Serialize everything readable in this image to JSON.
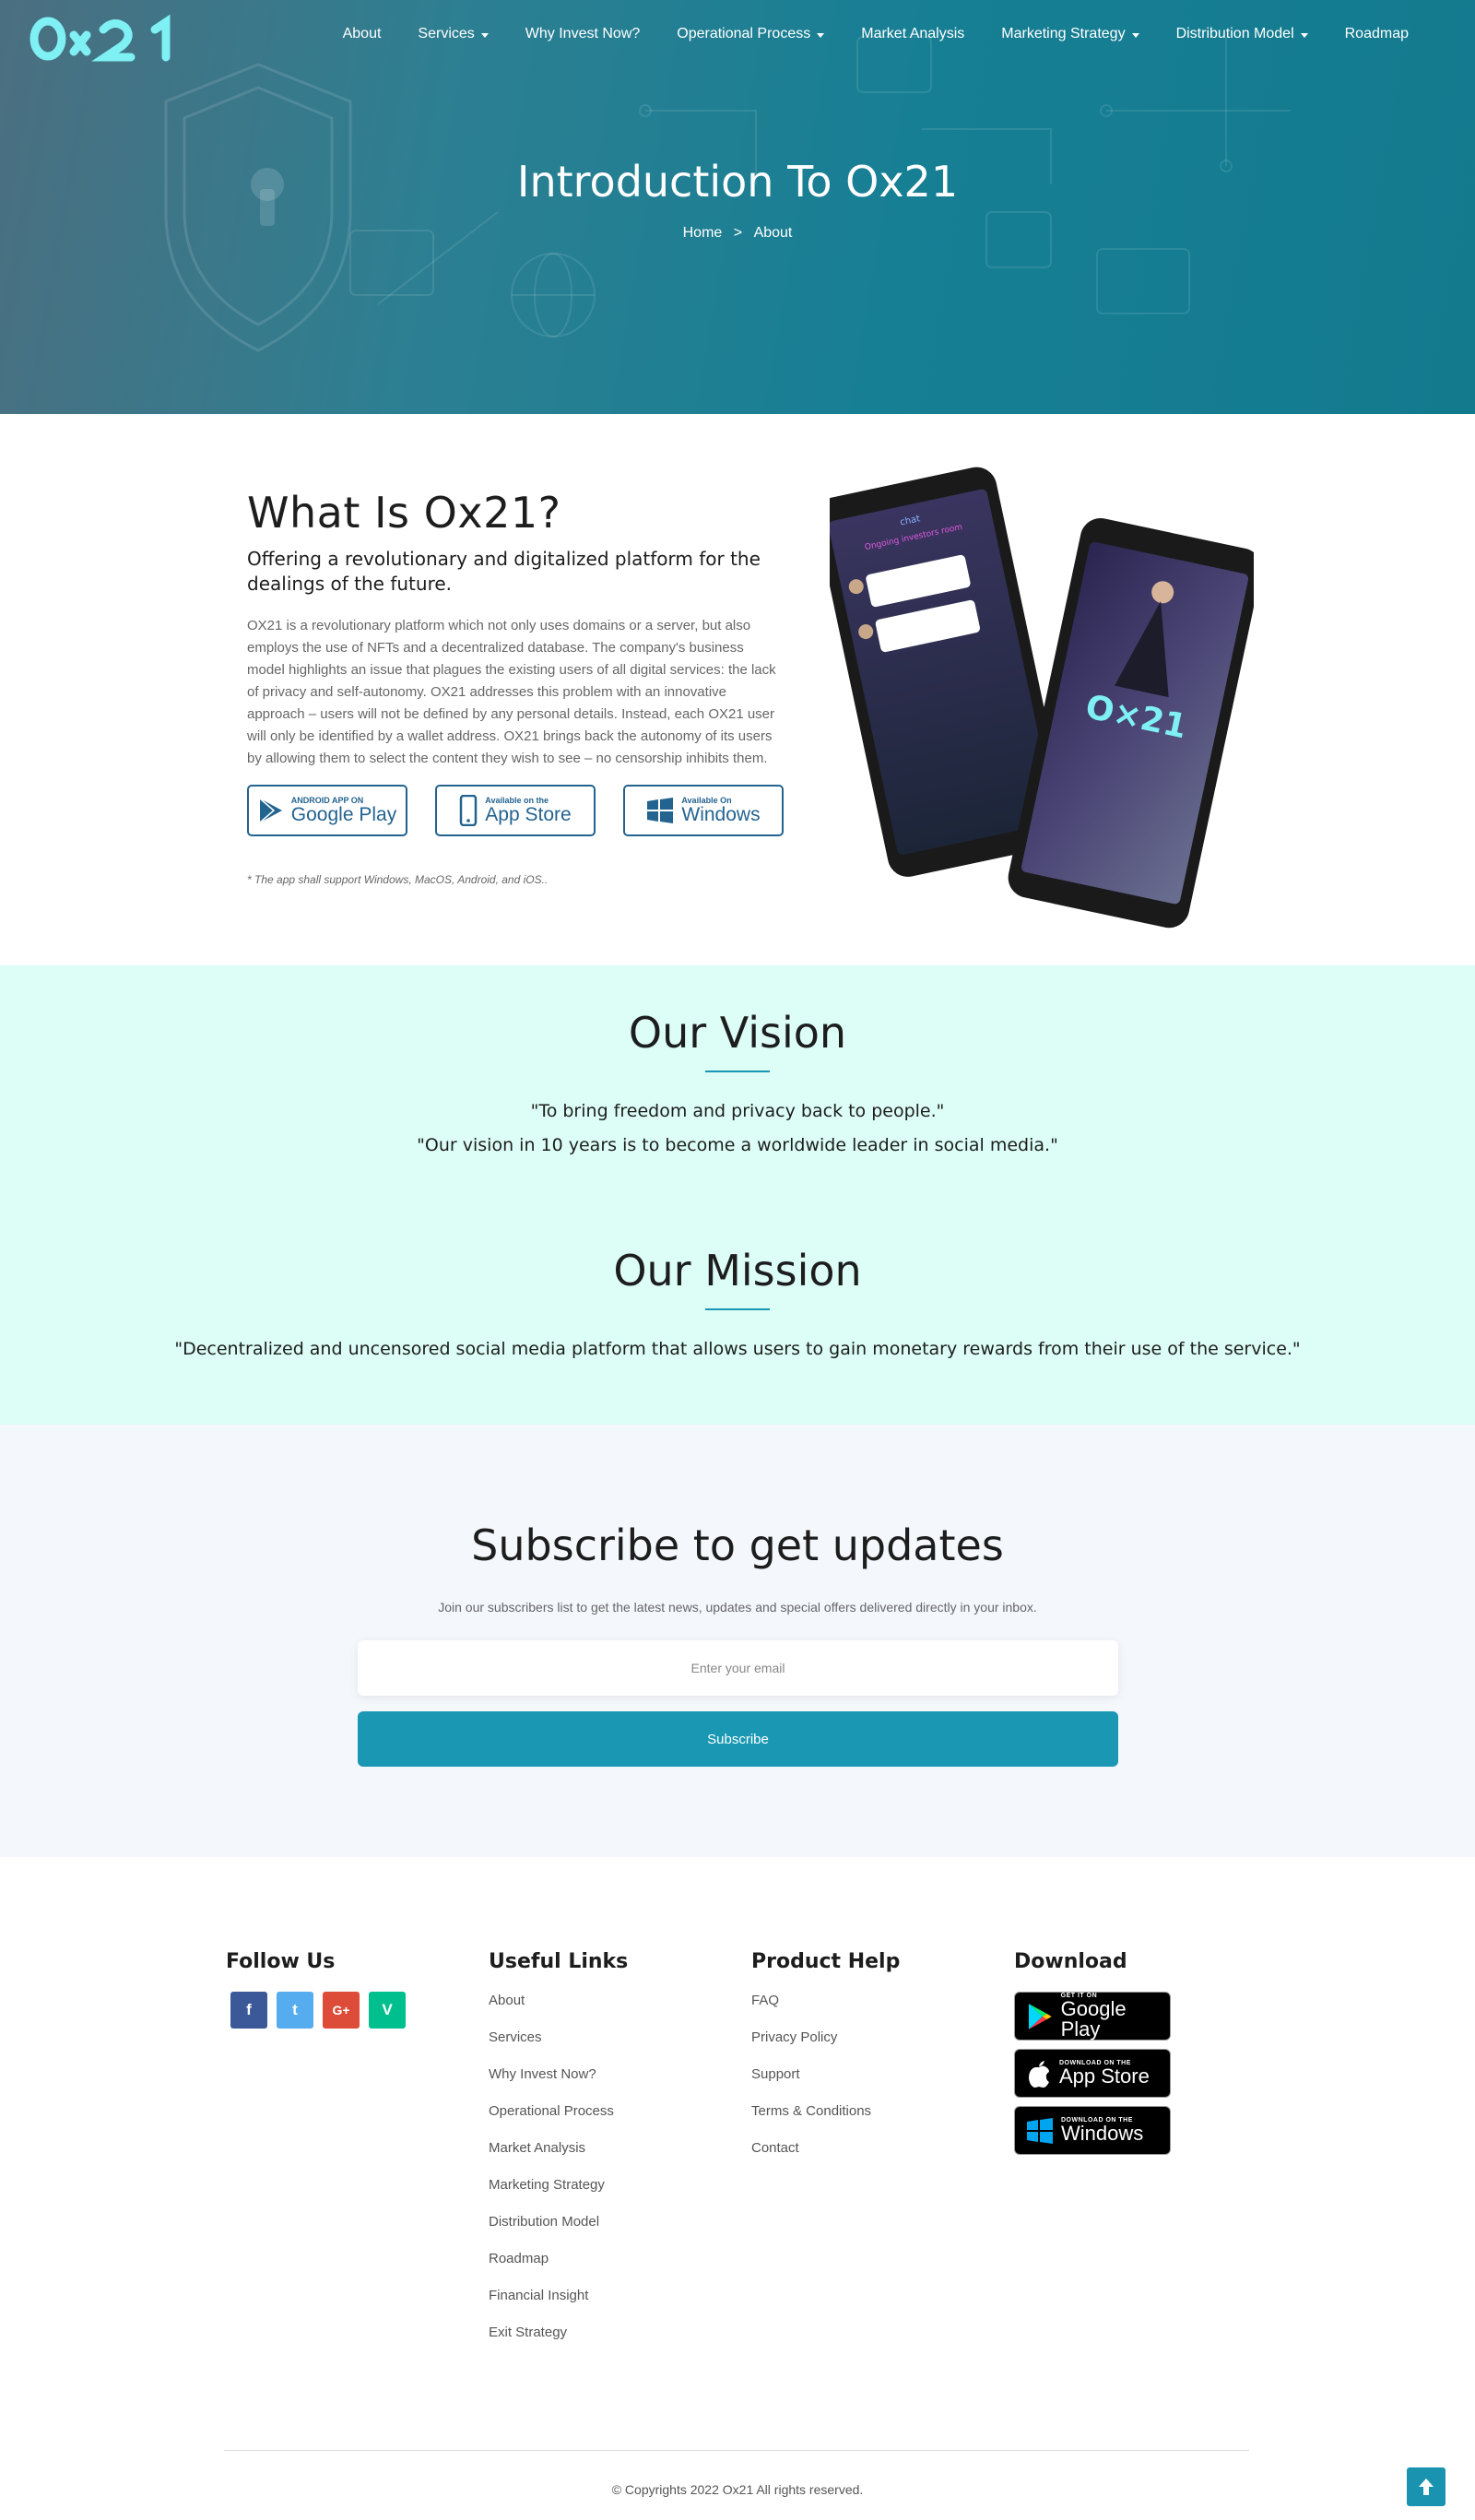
{
  "brand": {
    "logo_text": "Ox21",
    "accent": "#7ff0f3",
    "primary": "#1a98b3"
  },
  "nav": {
    "items": [
      {
        "label": "About",
        "dropdown": false
      },
      {
        "label": "Services",
        "dropdown": true
      },
      {
        "label": "Why Invest Now?",
        "dropdown": false
      },
      {
        "label": "Operational Process",
        "dropdown": true
      },
      {
        "label": "Market Analysis",
        "dropdown": false
      },
      {
        "label": "Marketing Strategy",
        "dropdown": true
      },
      {
        "label": "Distribution Model",
        "dropdown": true
      },
      {
        "label": "Roadmap",
        "dropdown": false
      }
    ]
  },
  "hero": {
    "title": "Introduction To Ox21",
    "breadcrumb_home": "Home",
    "breadcrumb_sep": ">",
    "breadcrumb_current": "About"
  },
  "about": {
    "heading": "What Is Ox21?",
    "subheading": "Offering a revolutionary and digitalized platform for the dealings of the future.",
    "body": "OX21 is a revolutionary platform which not only uses domains or a server, but also employs the use of NFTs and a decentralized database. The company's business model highlights an issue that plagues the existing users of all digital services: the lack of privacy and self-autonomy. OX21 addresses this problem with an innovative approach – users will not be defined by any personal details. Instead, each OX21 user will only be identified by a wallet address. OX21 brings back the autonomy of its users by allowing them to select the content they wish to see – no censorship inhibits them.",
    "stores": [
      {
        "small": "ANDROID APP ON",
        "big": "Google Play",
        "icon": "google-play-icon"
      },
      {
        "small": "Available on the",
        "big": "App Store",
        "icon": "phone-icon"
      },
      {
        "small": "Available On",
        "big": "Windows",
        "icon": "windows-icon"
      }
    ],
    "note": "* The app shall support Windows, MacOS, Android, and iOS..",
    "phone_chat_header": "chat",
    "phone_chat_room": "Ongoing investors room",
    "phone_logo": "O×21"
  },
  "vision": {
    "title": "Our Vision",
    "quote_1": "\"To bring freedom and privacy back to people.\"",
    "quote_2": "\"Our vision in 10 years is to become a worldwide leader in social media.\""
  },
  "mission": {
    "title": "Our Mission",
    "quote": "\"Decentralized and uncensored social media platform that allows users to gain monetary rewards from their use of the service.\""
  },
  "subscribe": {
    "title": "Subscribe to get updates",
    "description": "Join our subscribers list to get the latest news, updates and special offers delivered directly in your inbox.",
    "email_placeholder": "Enter your email",
    "button": "Subscribe"
  },
  "footer": {
    "follow": {
      "heading": "Follow Us",
      "socials": [
        {
          "label": "f",
          "icon": "facebook-icon",
          "color": "#3b5998"
        },
        {
          "label": "t",
          "icon": "twitter-icon",
          "color": "#55acee"
        },
        {
          "label": "G+",
          "icon": "google-plus-icon",
          "color": "#dd4b39"
        },
        {
          "label": "V",
          "icon": "vine-icon",
          "color": "#00bf8f"
        }
      ]
    },
    "useful": {
      "heading": "Useful Links",
      "links": [
        "About",
        "Services",
        "Why Invest Now?",
        "Operational Process",
        "Market Analysis",
        "Marketing Strategy",
        "Distribution Model",
        "Roadmap",
        "Financial Insight",
        "Exit Strategy"
      ]
    },
    "help": {
      "heading": "Product Help",
      "links": [
        "FAQ",
        "Privacy Policy",
        "Support",
        "Terms & Conditions",
        "Contact"
      ]
    },
    "download": {
      "heading": "Download",
      "buttons": [
        {
          "small": "GET IT ON",
          "big": "Google Play",
          "icon": "google-play-icon"
        },
        {
          "small": "DOWNLOAD ON THE",
          "big": "App Store",
          "icon": "apple-icon"
        },
        {
          "small": "DOWNLOAD ON THE",
          "big": "Windows",
          "icon": "windows-icon"
        }
      ]
    },
    "copyright": "© Copyrights 2022 Ox21 All rights reserved."
  }
}
